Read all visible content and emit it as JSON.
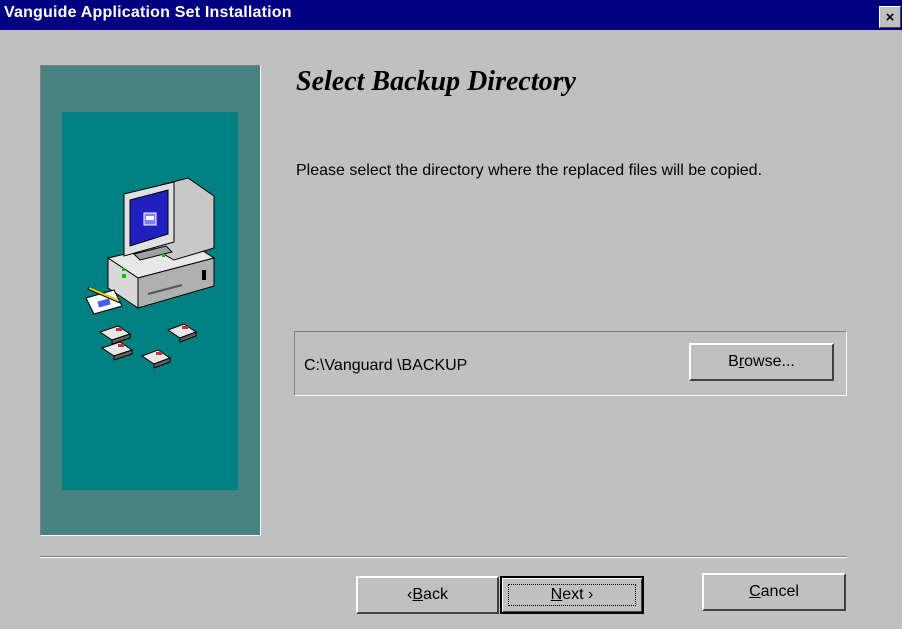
{
  "window": {
    "title": "Vanguide Application Set Installation",
    "close_label": "×"
  },
  "main": {
    "heading": "Select Backup Directory",
    "description": "Please select the directory where the replaced  files will be copied.",
    "backup_path": "C:\\Vanguard \\BACKUP"
  },
  "buttons": {
    "browse": {
      "label": "Browse...",
      "pre": "B",
      "mnemonic": "r",
      "post": "owse..."
    },
    "back": {
      "label": "< Back",
      "pre": "‹ ",
      "mnemonic": "B",
      "post": "ack"
    },
    "next": {
      "label": "Next >",
      "pre": "",
      "mnemonic": "N",
      "post": "ext ›"
    },
    "cancel": {
      "label": "Cancel",
      "pre": "",
      "mnemonic": "C",
      "post": "ancel"
    }
  },
  "colors": {
    "title_bar": "#000080",
    "dialog_bg": "#c0c0c0",
    "side_panel_outer": "#478380",
    "side_panel_inner": "#008080"
  },
  "icons": [
    "computer-icon",
    "notepad-icon",
    "floppy-disk-icon",
    "close-icon"
  ]
}
